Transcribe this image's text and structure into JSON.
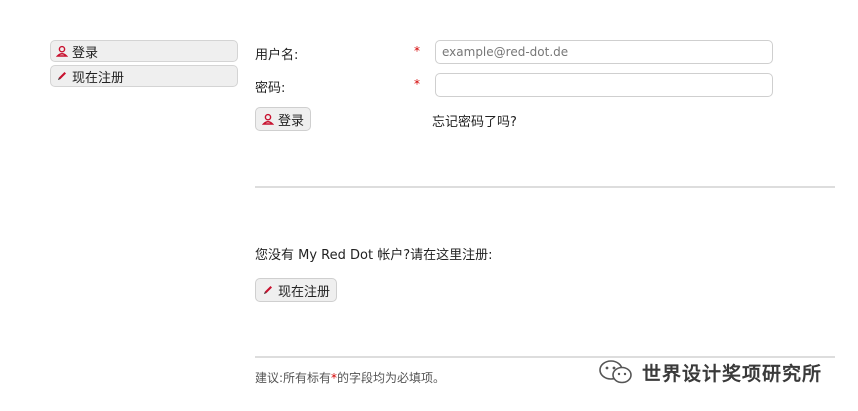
{
  "sidebar": {
    "login_label": "登录",
    "register_label": "现在注册"
  },
  "form": {
    "username_label": "用户名:",
    "password_label": "密码:",
    "required_mark": "*",
    "username_placeholder": "example@red-dot.de",
    "username_value": "",
    "password_value": "",
    "login_button": "登录",
    "forgot_link": "忘记密码了吗?"
  },
  "register_section": {
    "prompt": "您没有 My Red Dot 帐户?请在这里注册:",
    "register_button": "现在注册"
  },
  "footer": {
    "hint_prefix": "建议:所有标有",
    "hint_star": "*",
    "hint_suffix": "的字段均为必填项。"
  },
  "watermark": {
    "text": "世界设计奖项研究所",
    "icon": "wechat-icon"
  },
  "colors": {
    "required": "#d40000",
    "icon_red": "#c8102e",
    "button_bg": "#efefef"
  }
}
